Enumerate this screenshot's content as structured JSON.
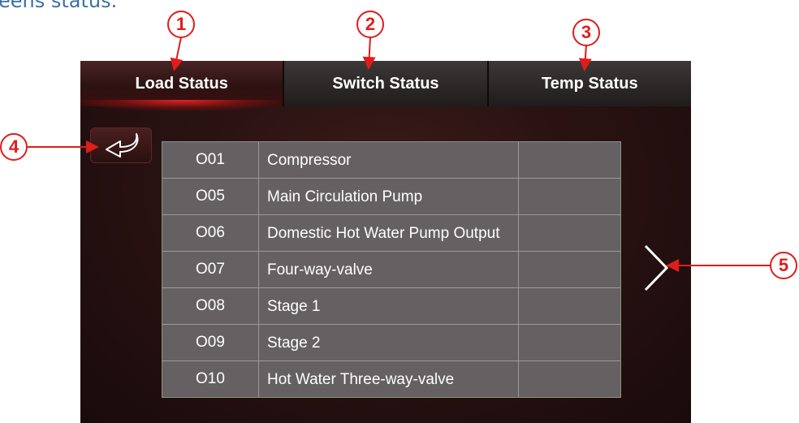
{
  "caption": "eens status.",
  "tabs": [
    {
      "label": "Load Status",
      "active": true
    },
    {
      "label": "Switch Status",
      "active": false
    },
    {
      "label": "Temp Status",
      "active": false
    }
  ],
  "table": {
    "rows": [
      {
        "code": "O01",
        "name": "Compressor",
        "value": ""
      },
      {
        "code": "O05",
        "name": "Main Circulation Pump",
        "value": ""
      },
      {
        "code": "O06",
        "name": "Domestic Hot Water Pump Output",
        "value": ""
      },
      {
        "code": "O07",
        "name": "Four-way-valve",
        "value": ""
      },
      {
        "code": "O08",
        "name": "Stage 1",
        "value": ""
      },
      {
        "code": "O09",
        "name": "Stage 2",
        "value": ""
      },
      {
        "code": "O10",
        "name": "Hot Water Three-way-valve",
        "value": ""
      }
    ]
  },
  "icons": {
    "back": "return-arrow-icon",
    "next": "chevron-right-icon"
  },
  "callouts": [
    "1",
    "2",
    "3",
    "4",
    "5"
  ],
  "colors": {
    "callout": "#e11c1c",
    "caption": "#3c6ea7",
    "screen_bg": "#2a1212",
    "table_bg": "#656162"
  }
}
